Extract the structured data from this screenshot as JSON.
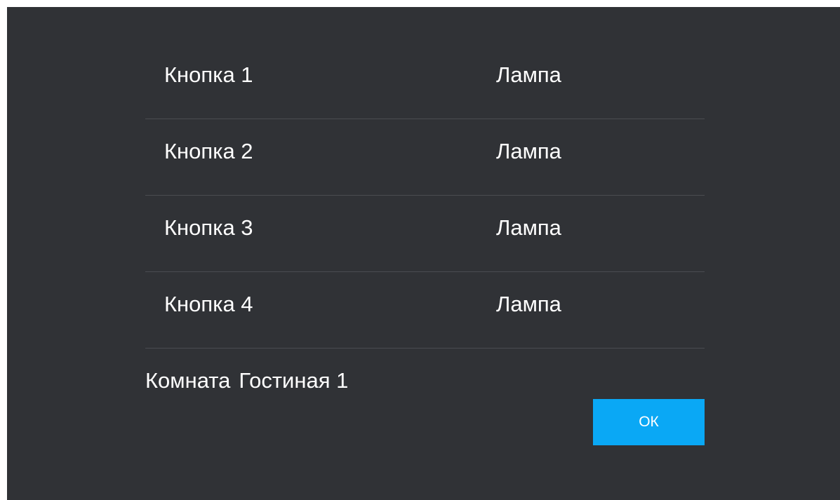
{
  "buttons": [
    {
      "label": "Кнопка 1",
      "device": "Лампа"
    },
    {
      "label": "Кнопка 2",
      "device": "Лампа"
    },
    {
      "label": "Кнопка 3",
      "device": "Лампа"
    },
    {
      "label": "Кнопка 4",
      "device": "Лампа"
    }
  ],
  "room": {
    "label": "Комната",
    "value": "Гостиная 1"
  },
  "ok_label": "ОК",
  "colors": {
    "background": "#303236",
    "divider": "#4a4c51",
    "accent": "#0aa8f5",
    "text": "#ffffff"
  }
}
